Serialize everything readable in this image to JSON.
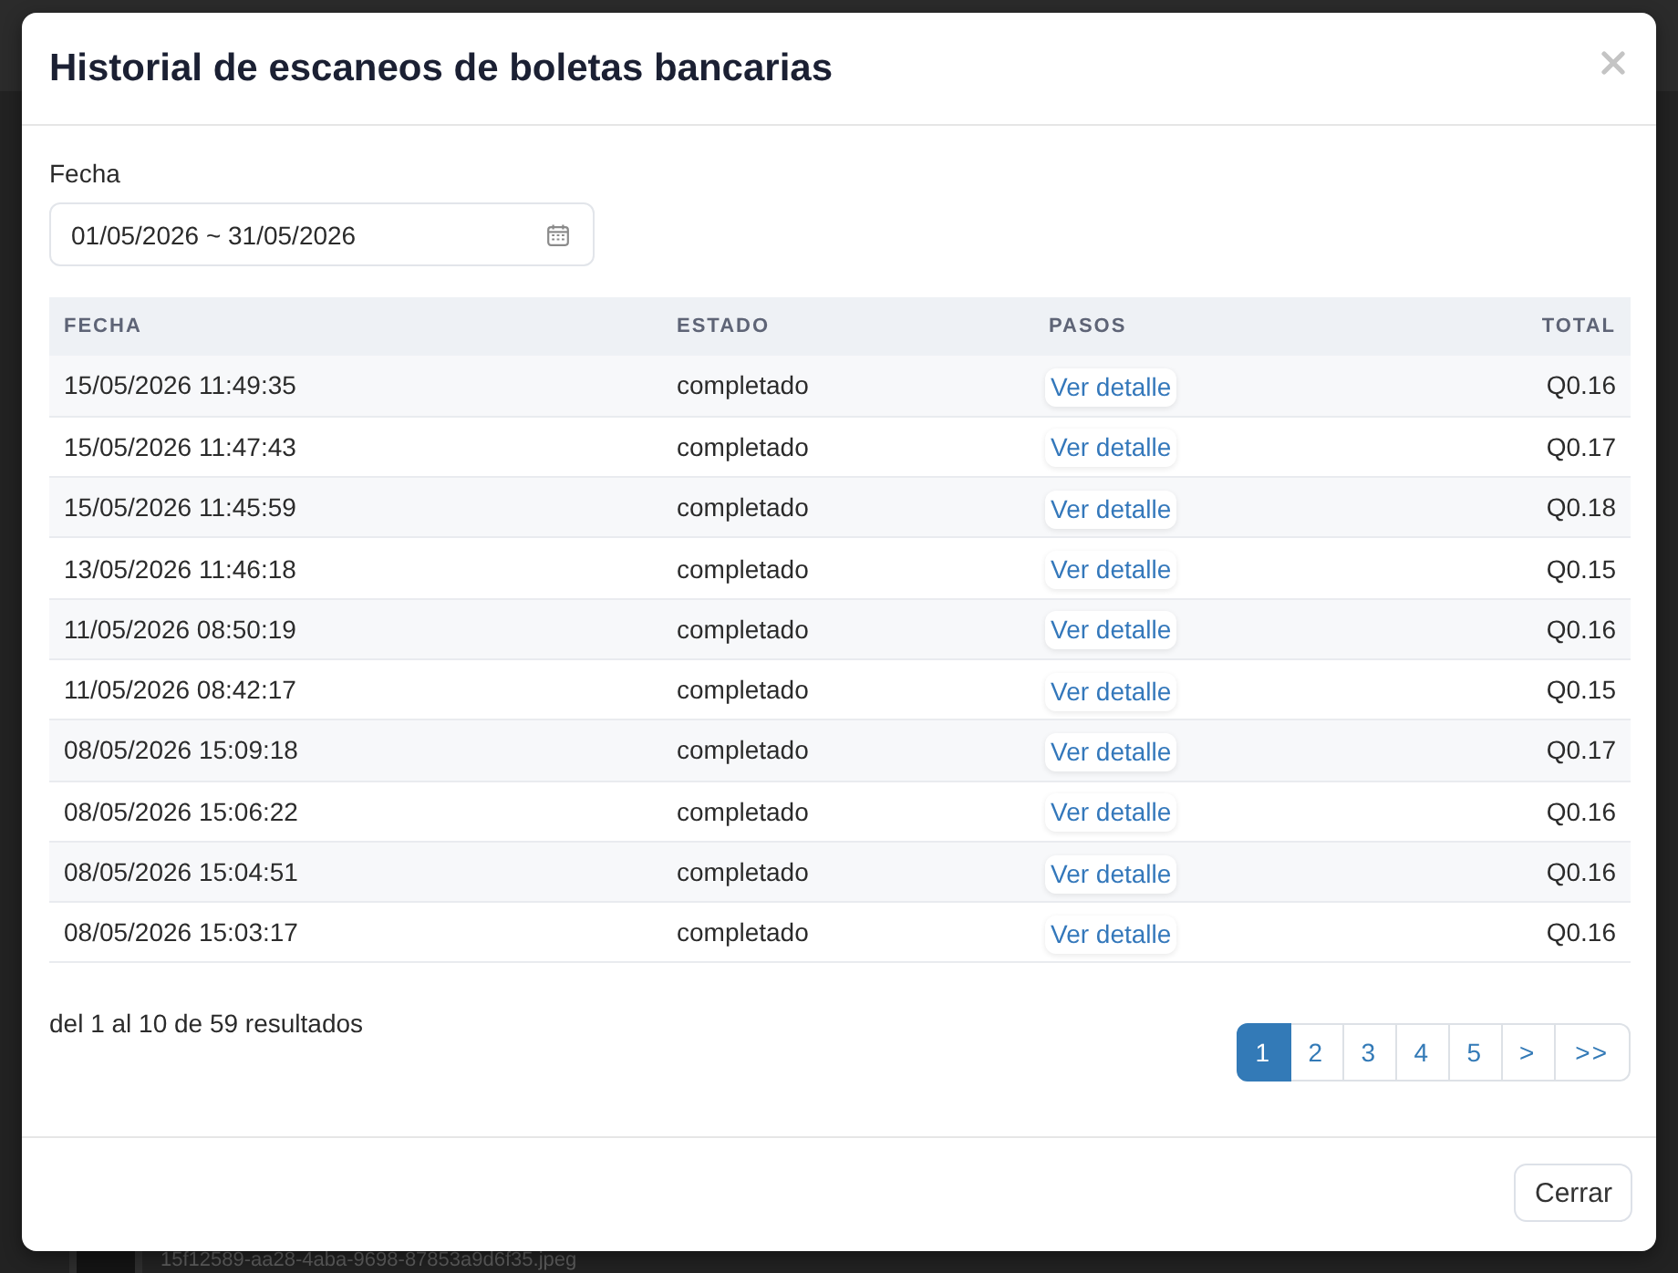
{
  "dialog": {
    "title": "Historial de escaneos de boletas bancarias"
  },
  "filter": {
    "label": "Fecha",
    "value": "01/05/2026 ~ 31/05/2026"
  },
  "table": {
    "columns": [
      "FECHA",
      "ESTADO",
      "PASOS",
      "TOTAL"
    ],
    "rows": [
      {
        "date": "15/05/2026 11:49:35",
        "status": "completado",
        "steps": "Ver detalle",
        "total": "Q0.16"
      },
      {
        "date": "15/05/2026 11:47:43",
        "status": "completado",
        "steps": "Ver detalle",
        "total": "Q0.17"
      },
      {
        "date": "15/05/2026 11:45:59",
        "status": "completado",
        "steps": "Ver detalle",
        "total": "Q0.18"
      },
      {
        "date": "13/05/2026 11:46:18",
        "status": "completado",
        "steps": "Ver detalle",
        "total": "Q0.15"
      },
      {
        "date": "11/05/2026 08:50:19",
        "status": "completado",
        "steps": "Ver detalle",
        "total": "Q0.16"
      },
      {
        "date": "11/05/2026 08:42:17",
        "status": "completado",
        "steps": "Ver detalle",
        "total": "Q0.15"
      },
      {
        "date": "08/05/2026 15:09:18",
        "status": "completado",
        "steps": "Ver detalle",
        "total": "Q0.17"
      },
      {
        "date": "08/05/2026 15:06:22",
        "status": "completado",
        "steps": "Ver detalle",
        "total": "Q0.16"
      },
      {
        "date": "08/05/2026 15:04:51",
        "status": "completado",
        "steps": "Ver detalle",
        "total": "Q0.16"
      },
      {
        "date": "08/05/2026 15:03:17",
        "status": "completado",
        "steps": "Ver detalle",
        "total": "Q0.16"
      }
    ]
  },
  "summary": "del 1 al 10 de 59 resultados",
  "pagination": [
    {
      "label": "1",
      "selected": true
    },
    {
      "label": "2",
      "selected": false
    },
    {
      "label": "3",
      "selected": false
    },
    {
      "label": "4",
      "selected": false
    },
    {
      "label": "5",
      "selected": false
    },
    {
      "label": ">",
      "selected": false
    },
    {
      "label": ">>",
      "selected": false
    }
  ],
  "footer": {
    "close_button": "Cerrar"
  },
  "background": {
    "file_name": "15f12589-aa28-4aba-9698-87853a9d6f35.jpeg"
  }
}
